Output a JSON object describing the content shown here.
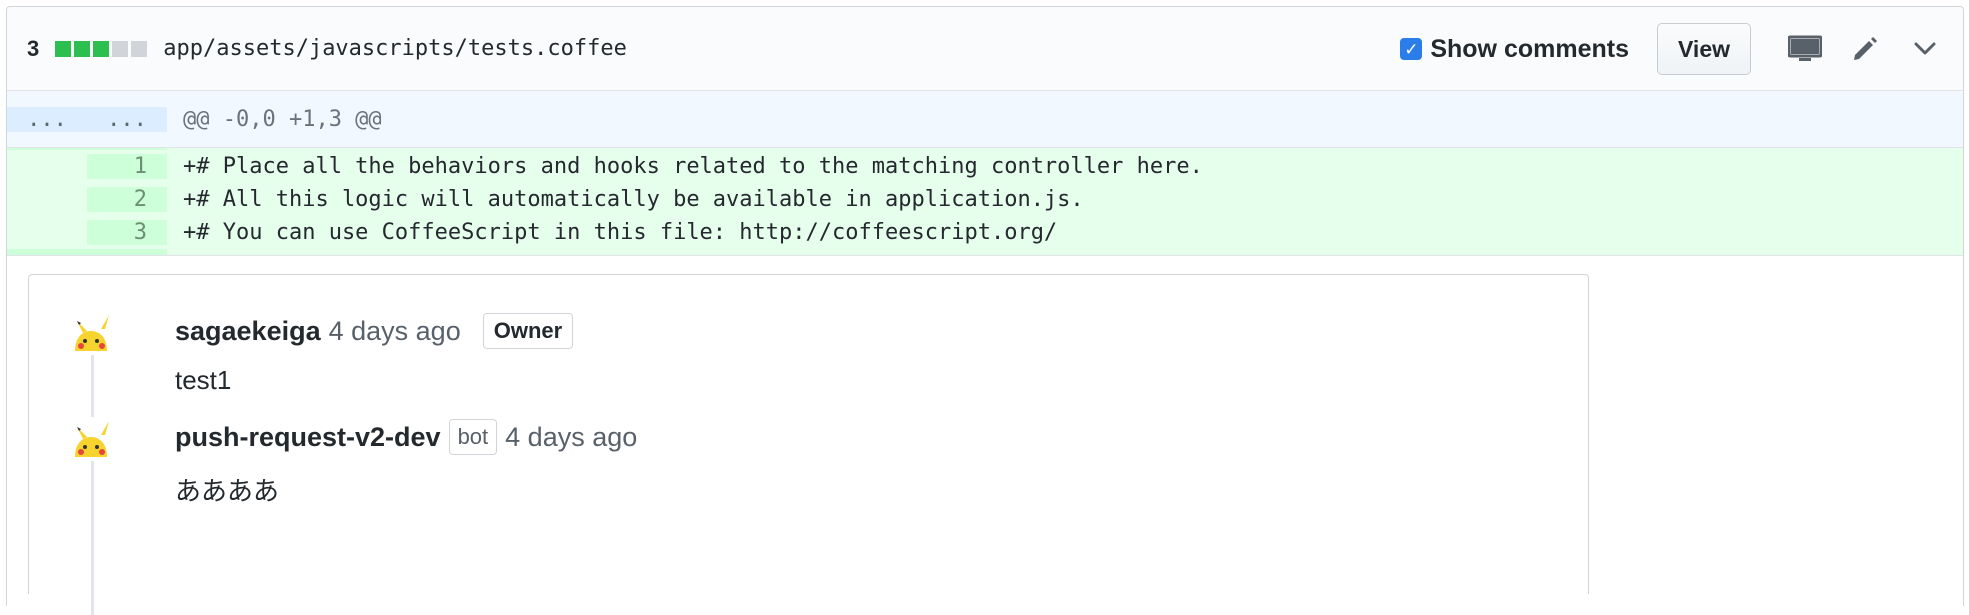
{
  "file": {
    "change_count": "3",
    "diffstat": [
      "add",
      "add",
      "add",
      "neutral",
      "neutral"
    ],
    "path": "app/assets/javascripts/tests.coffee",
    "show_comments": {
      "label": "Show comments",
      "checked": true
    },
    "view_button": "View",
    "icons": [
      "desktop-icon",
      "pencil-icon",
      "chevron-down-icon"
    ]
  },
  "diff": {
    "hunk": {
      "old": "...",
      "new": "...",
      "header": "@@ -0,0 +1,3 @@"
    },
    "lines": [
      {
        "num": "1",
        "code": "+# Place all the behaviors and hooks related to the matching controller here."
      },
      {
        "num": "2",
        "code": "+# All this logic will automatically be available in application.js."
      },
      {
        "num": "3",
        "code": "+# You can use CoffeeScript in this file: http://coffeescript.org/"
      }
    ]
  },
  "comments": [
    {
      "author": "sagaekeiga",
      "time": "4 days ago",
      "badge": "Owner",
      "text": "test1"
    },
    {
      "author": "push-request-v2-dev",
      "badge": "bot",
      "time": "4 days ago",
      "text": "ああああ"
    }
  ],
  "colors": {
    "addition": "#e6ffed",
    "addition_gutter": "#cdffd8",
    "hunk": "#f1f8ff",
    "checkbox": "#2b7de9",
    "diffstat_green": "#2cbe4e"
  }
}
